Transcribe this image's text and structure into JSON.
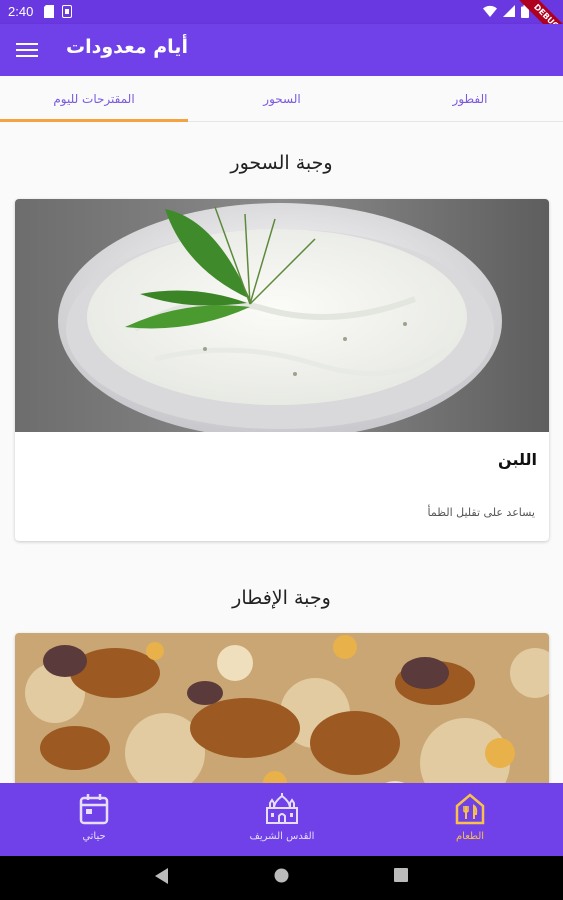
{
  "status_bar": {
    "time": "2:40",
    "debug_label": "DEBUG"
  },
  "app_bar": {
    "title": "أيام معدودات"
  },
  "tabs": [
    {
      "label": "الفطور",
      "active": false
    },
    {
      "label": "السحور",
      "active": false
    },
    {
      "label": "المقترحات لليوم",
      "active": true
    }
  ],
  "suhoor": {
    "heading": "وجبة السحور",
    "card_title": "اللبن",
    "card_description": "يساعد على تقليل الظمأ"
  },
  "iftar": {
    "heading": "وجبة الإفطار"
  },
  "bottom_nav": [
    {
      "label": "حياتي",
      "icon": "calendar-icon",
      "active": false
    },
    {
      "label": "القدس الشريف",
      "icon": "mosque-icon",
      "active": false
    },
    {
      "label": "الطعام",
      "icon": "restaurant-icon",
      "active": true
    }
  ],
  "colors": {
    "primary": "#7040e8",
    "accent": "#f4a340",
    "active_nav": "#f7c24a"
  }
}
